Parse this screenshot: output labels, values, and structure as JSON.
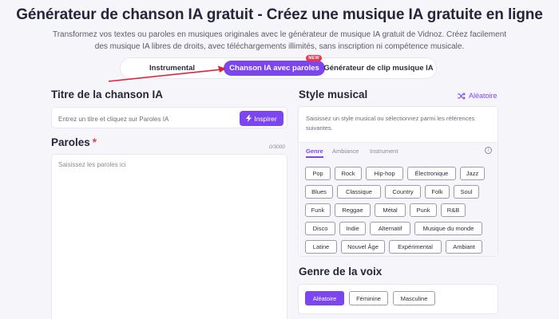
{
  "header": {
    "title": "Générateur de chanson IA gratuit - Créez une musique IA gratuite en ligne",
    "subtitle": "Transformez vos textes ou paroles en musiques originales avec le générateur de musique IA gratuit de Vidnoz. Créez facilement des musique IA libres de droits, avec téléchargements illimités, sans inscription ni compétence musicale."
  },
  "tabs": {
    "instrumental": "Instrumental",
    "chanson": "Chanson IA avec paroles",
    "new_badge": "NEW",
    "clip": "Générateur de clip musique IA"
  },
  "song_title": {
    "label": "Titre de la chanson IA",
    "placeholder": "Entrez un titre et cliquez sur Paroles IA",
    "inspire_label": "Inspirer"
  },
  "lyrics": {
    "label": "Paroles",
    "required": "*",
    "counter": "0/3000",
    "placeholder": "Saisissez les paroles ici"
  },
  "style": {
    "label": "Style musical",
    "random_label": "Aléatoire",
    "description": "Saisissez un style musical ou sélectionnez parmi les références suivantes.",
    "subtabs": {
      "genre": "Genre",
      "ambiance": "Ambiance",
      "instrument": "Instrument"
    },
    "info": "i",
    "chips": [
      "Pop",
      "Rock",
      "Hip-hop",
      "Électronique",
      "Jazz",
      "Blues",
      "Classique",
      "Country",
      "Folk",
      "Soul",
      "Funk",
      "Reggae",
      "Métal",
      "Punk",
      "R&B",
      "Disco",
      "Indie",
      "Alternatif",
      "Musique du monde",
      "Latine",
      "Nouvel Âge",
      "Expérimental",
      "Ambiant"
    ]
  },
  "voice": {
    "label": "Genre de la voix",
    "options": [
      "Aléatoire",
      "Féminine",
      "Masculine"
    ],
    "selected": "Aléatoire"
  },
  "colors": {
    "accent": "#7b46f0",
    "badge": "#f0344c",
    "arrow": "#e0213a"
  }
}
